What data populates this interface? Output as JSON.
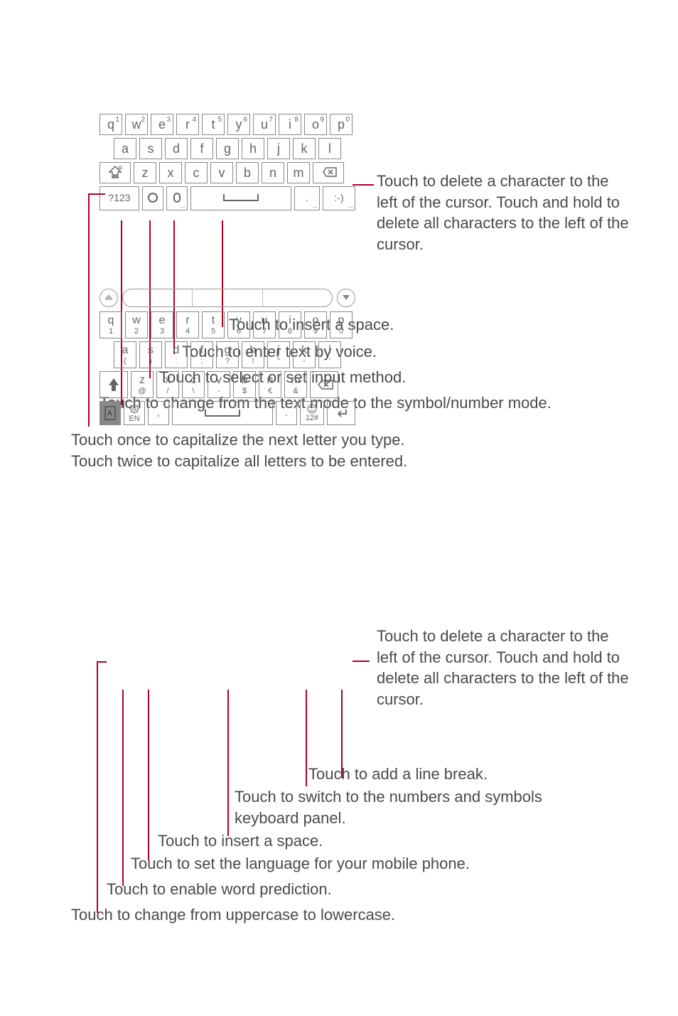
{
  "kb1": {
    "row1": [
      {
        "l": "q",
        "n": "1"
      },
      {
        "l": "w",
        "n": "2"
      },
      {
        "l": "e",
        "n": "3"
      },
      {
        "l": "r",
        "n": "4"
      },
      {
        "l": "t",
        "n": "5"
      },
      {
        "l": "y",
        "n": "6"
      },
      {
        "l": "u",
        "n": "7"
      },
      {
        "l": "i",
        "n": "8"
      },
      {
        "l": "o",
        "n": "9"
      },
      {
        "l": "p",
        "n": "0"
      }
    ],
    "row2": [
      "a",
      "s",
      "d",
      "f",
      "g",
      "h",
      "j",
      "k",
      "l"
    ],
    "row3": [
      "z",
      "x",
      "c",
      "v",
      "b",
      "n",
      "m"
    ],
    "row4": {
      "mode": "?123",
      "period": ".",
      "smile": ":-)"
    }
  },
  "kb2": {
    "row1": [
      {
        "l": "q",
        "n": "1"
      },
      {
        "l": "w",
        "n": "2"
      },
      {
        "l": "e",
        "n": "3"
      },
      {
        "l": "r",
        "n": "4"
      },
      {
        "l": "t",
        "n": "5"
      },
      {
        "l": "y",
        "n": "6"
      },
      {
        "l": "u",
        "n": "7"
      },
      {
        "l": "i",
        "n": "8"
      },
      {
        "l": "o",
        "n": "9"
      },
      {
        "l": "p",
        "n": "0"
      }
    ],
    "row2": [
      {
        "l": "a",
        "n": "("
      },
      {
        "l": "s",
        "n": ")"
      },
      {
        "l": "d",
        "n": ":"
      },
      {
        "l": "f",
        "n": ";"
      },
      {
        "l": "g",
        "n": "?"
      },
      {
        "l": "h",
        "n": "!"
      },
      {
        "l": "j",
        "n": "\""
      },
      {
        "l": "k",
        "n": "-"
      },
      {
        "l": "l",
        "n": "'"
      }
    ],
    "row3": [
      {
        "l": "z",
        "n": "@"
      },
      {
        "l": "x",
        "n": "/"
      },
      {
        "l": "c",
        "n": "\\"
      },
      {
        "l": "v",
        "n": "-"
      },
      {
        "l": "b",
        "n": "$"
      },
      {
        "l": "n",
        "n": "€"
      },
      {
        "l": "m",
        "n": "&"
      }
    ],
    "row4": {
      "lang": "EN",
      "comma": ",",
      "period": ".",
      "sym": "12#"
    }
  },
  "ann": {
    "delete1": "Touch to delete a character to the left of the cursor. Touch and hold to delete all characters to the left of the cursor.",
    "space1": "Touch to insert a space.",
    "voice": "Touch to enter text by voice.",
    "method": "Touch to select or set input method.",
    "mode": "Touch to change from the text mode to the symbol/number mode.",
    "shift": "Touch once to capitalize the next letter you type.\nTouch twice to capitalize all letters to be entered.",
    "delete2": "Touch to delete a character to the left of the cursor. Touch and hold to delete all characters to the left of the cursor.",
    "linebreak": "Touch to add a line break.",
    "numsym": "Touch to switch to the numbers and symbols keyboard panel.",
    "space2": "Touch to insert a space.",
    "lang": "Touch to set the language for your mobile phone.",
    "predict": "Touch to enable word prediction.",
    "case": "Touch to change from uppercase to lowercase."
  }
}
